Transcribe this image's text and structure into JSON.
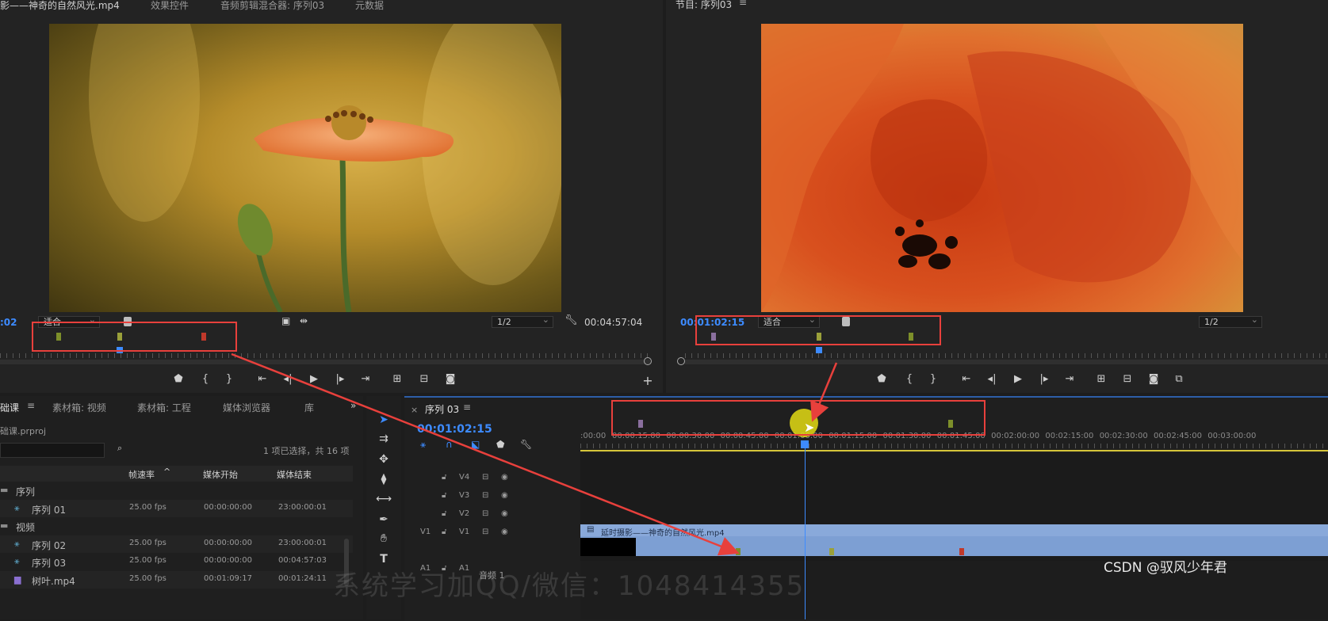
{
  "source_monitor": {
    "tabs": [
      "影——神奇的自然风光.mp4",
      "效果控件",
      "音频剪辑混合器: 序列03",
      "元数据"
    ],
    "timecode_left": ":02",
    "zoom": "适合",
    "resolution": "1/2",
    "duration": "00:04:57:04"
  },
  "program_monitor": {
    "title": "节目: 序列03",
    "timecode": "00:01:02:15",
    "zoom": "适合",
    "resolution": "1/2"
  },
  "project_panel": {
    "tabs": [
      "础课",
      "素材箱: 视频",
      "素材箱: 工程",
      "媒体浏览器",
      "库"
    ],
    "project_name": "础课.prproj",
    "selection_info": "1 项已选择，共 16 项",
    "columns": [
      "帧速率",
      "媒体开始",
      "媒体结束"
    ],
    "rows": [
      {
        "kind": "folder",
        "name": "序列",
        "fps": "",
        "start": "",
        "end": ""
      },
      {
        "kind": "seq",
        "name": "序列 01",
        "fps": "25.00 fps",
        "start": "00:00:00:00",
        "end": "23:00:00:01"
      },
      {
        "kind": "folder",
        "name": "视频",
        "fps": "",
        "start": "",
        "end": ""
      },
      {
        "kind": "seq",
        "name": "序列 02",
        "fps": "25.00 fps",
        "start": "00:00:00:00",
        "end": "23:00:00:01"
      },
      {
        "kind": "seq",
        "name": "序列 03",
        "fps": "25.00 fps",
        "start": "00:00:00:00",
        "end": "00:04:57:03"
      },
      {
        "kind": "clip",
        "name": "树叶.mp4",
        "fps": "25.00 fps",
        "start": "00:01:09:17",
        "end": "00:01:24:11"
      }
    ]
  },
  "timeline": {
    "tab": "序列 03",
    "close": "×",
    "timecode": "00:01:02:15",
    "ruler_labels": [
      ":00:00",
      "00:00:15:00",
      "00:00:30:00",
      "00:00:45:00",
      "00:01:00:00",
      "00:01:15:00",
      "00:01:30:00",
      "00:01:45:00",
      "00:02:00:00",
      "00:02:15:00",
      "00:02:30:00",
      "00:02:45:00",
      "00:03:00:00"
    ],
    "tracks": [
      "V4",
      "V3",
      "V2",
      "V1",
      "A1"
    ],
    "clip_name": "延时摄影——神奇的自然风光.mp4",
    "audio_track_name": "音频 1"
  },
  "watermark": "CSDN @驭风少年君",
  "overlay_text": "系统学习加QQ/微信：1048414355",
  "colors": {
    "accent_blue": "#3d8bff",
    "annotation_red": "#e8403c",
    "clip_blue": "#7d9fd3",
    "marker_green": "#7d8f2a",
    "marker_red": "#c0392b",
    "marker_purple": "#8a6f9e"
  }
}
